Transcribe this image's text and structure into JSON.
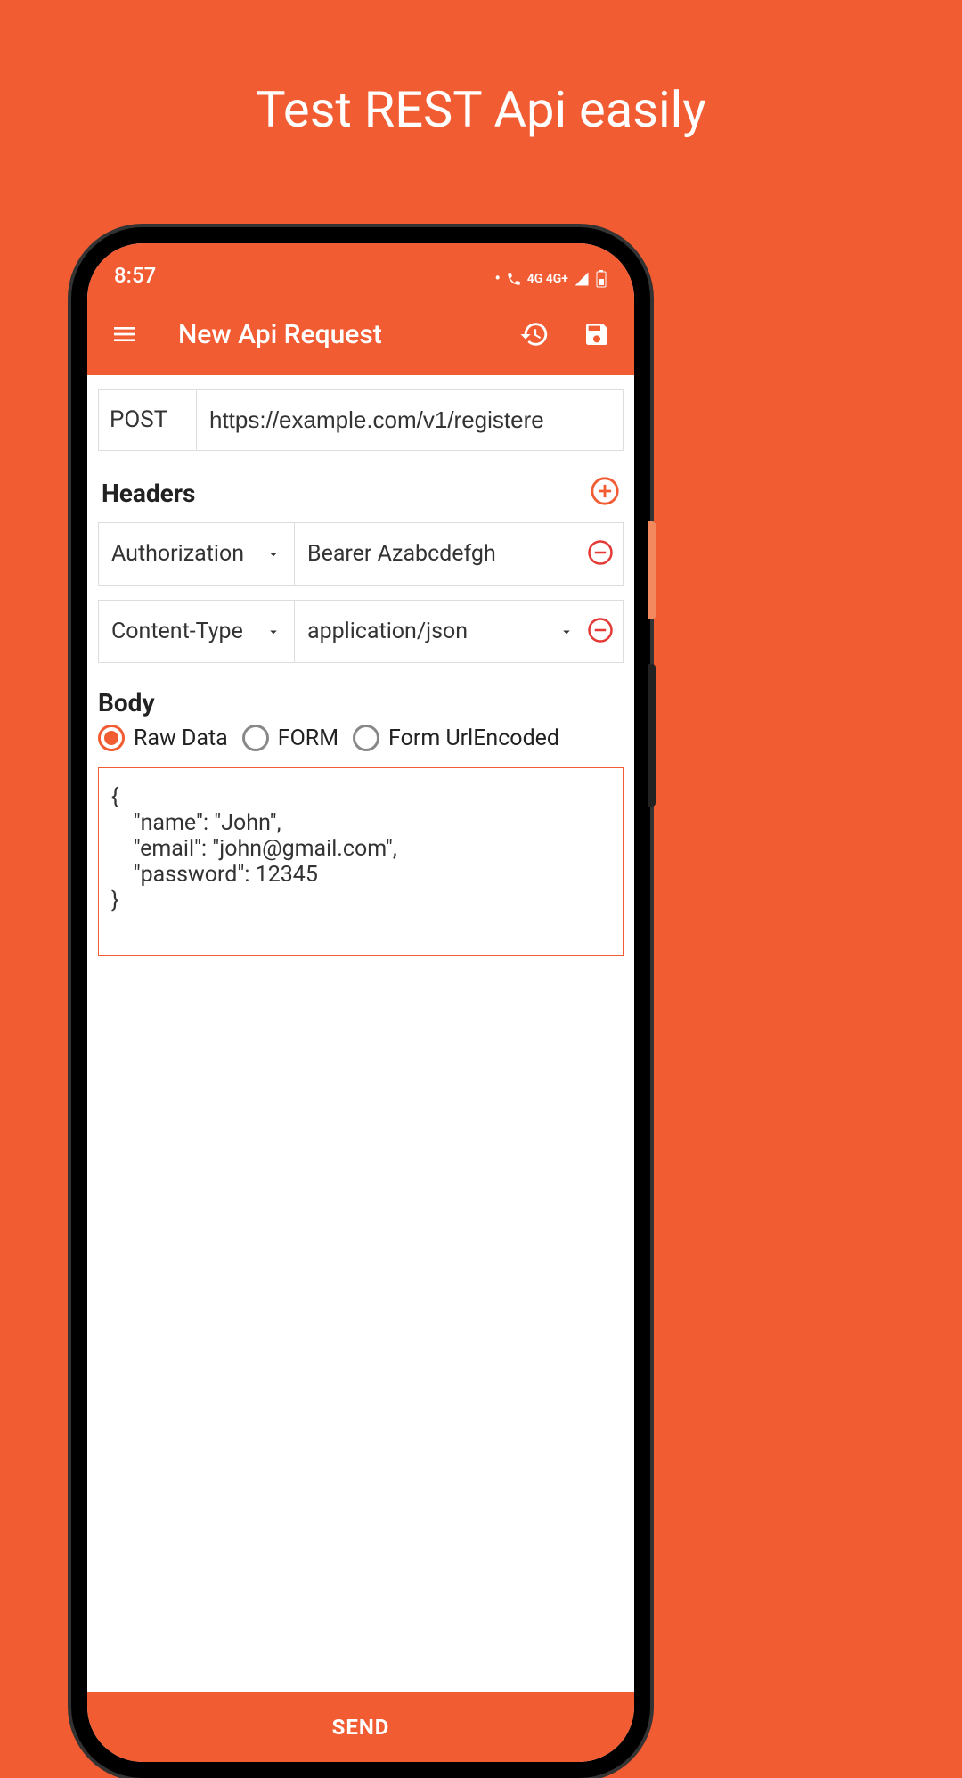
{
  "promo": {
    "title": "Test REST Api easily"
  },
  "status": {
    "time": "8:57",
    "signal_text": "4G 4G+"
  },
  "appbar": {
    "title": "New Api Request"
  },
  "request": {
    "method": "POST",
    "url": "https://example.com/v1/registere"
  },
  "sections": {
    "headers_label": "Headers",
    "body_label": "Body"
  },
  "headers": [
    {
      "key": "Authorization",
      "value": "Bearer Azabcdefgh",
      "value_dropdown": false
    },
    {
      "key": "Content-Type",
      "value": "application/json",
      "value_dropdown": true
    }
  ],
  "body": {
    "options": {
      "raw": "Raw Data",
      "form": "FORM",
      "urlencoded": "Form UrlEncoded"
    },
    "selected": "raw",
    "content": "{\n    \"name\": \"John\",\n    \"email\": \"john@gmail.com\",\n    \"password\": 12345\n}"
  },
  "actions": {
    "send": "SEND"
  }
}
